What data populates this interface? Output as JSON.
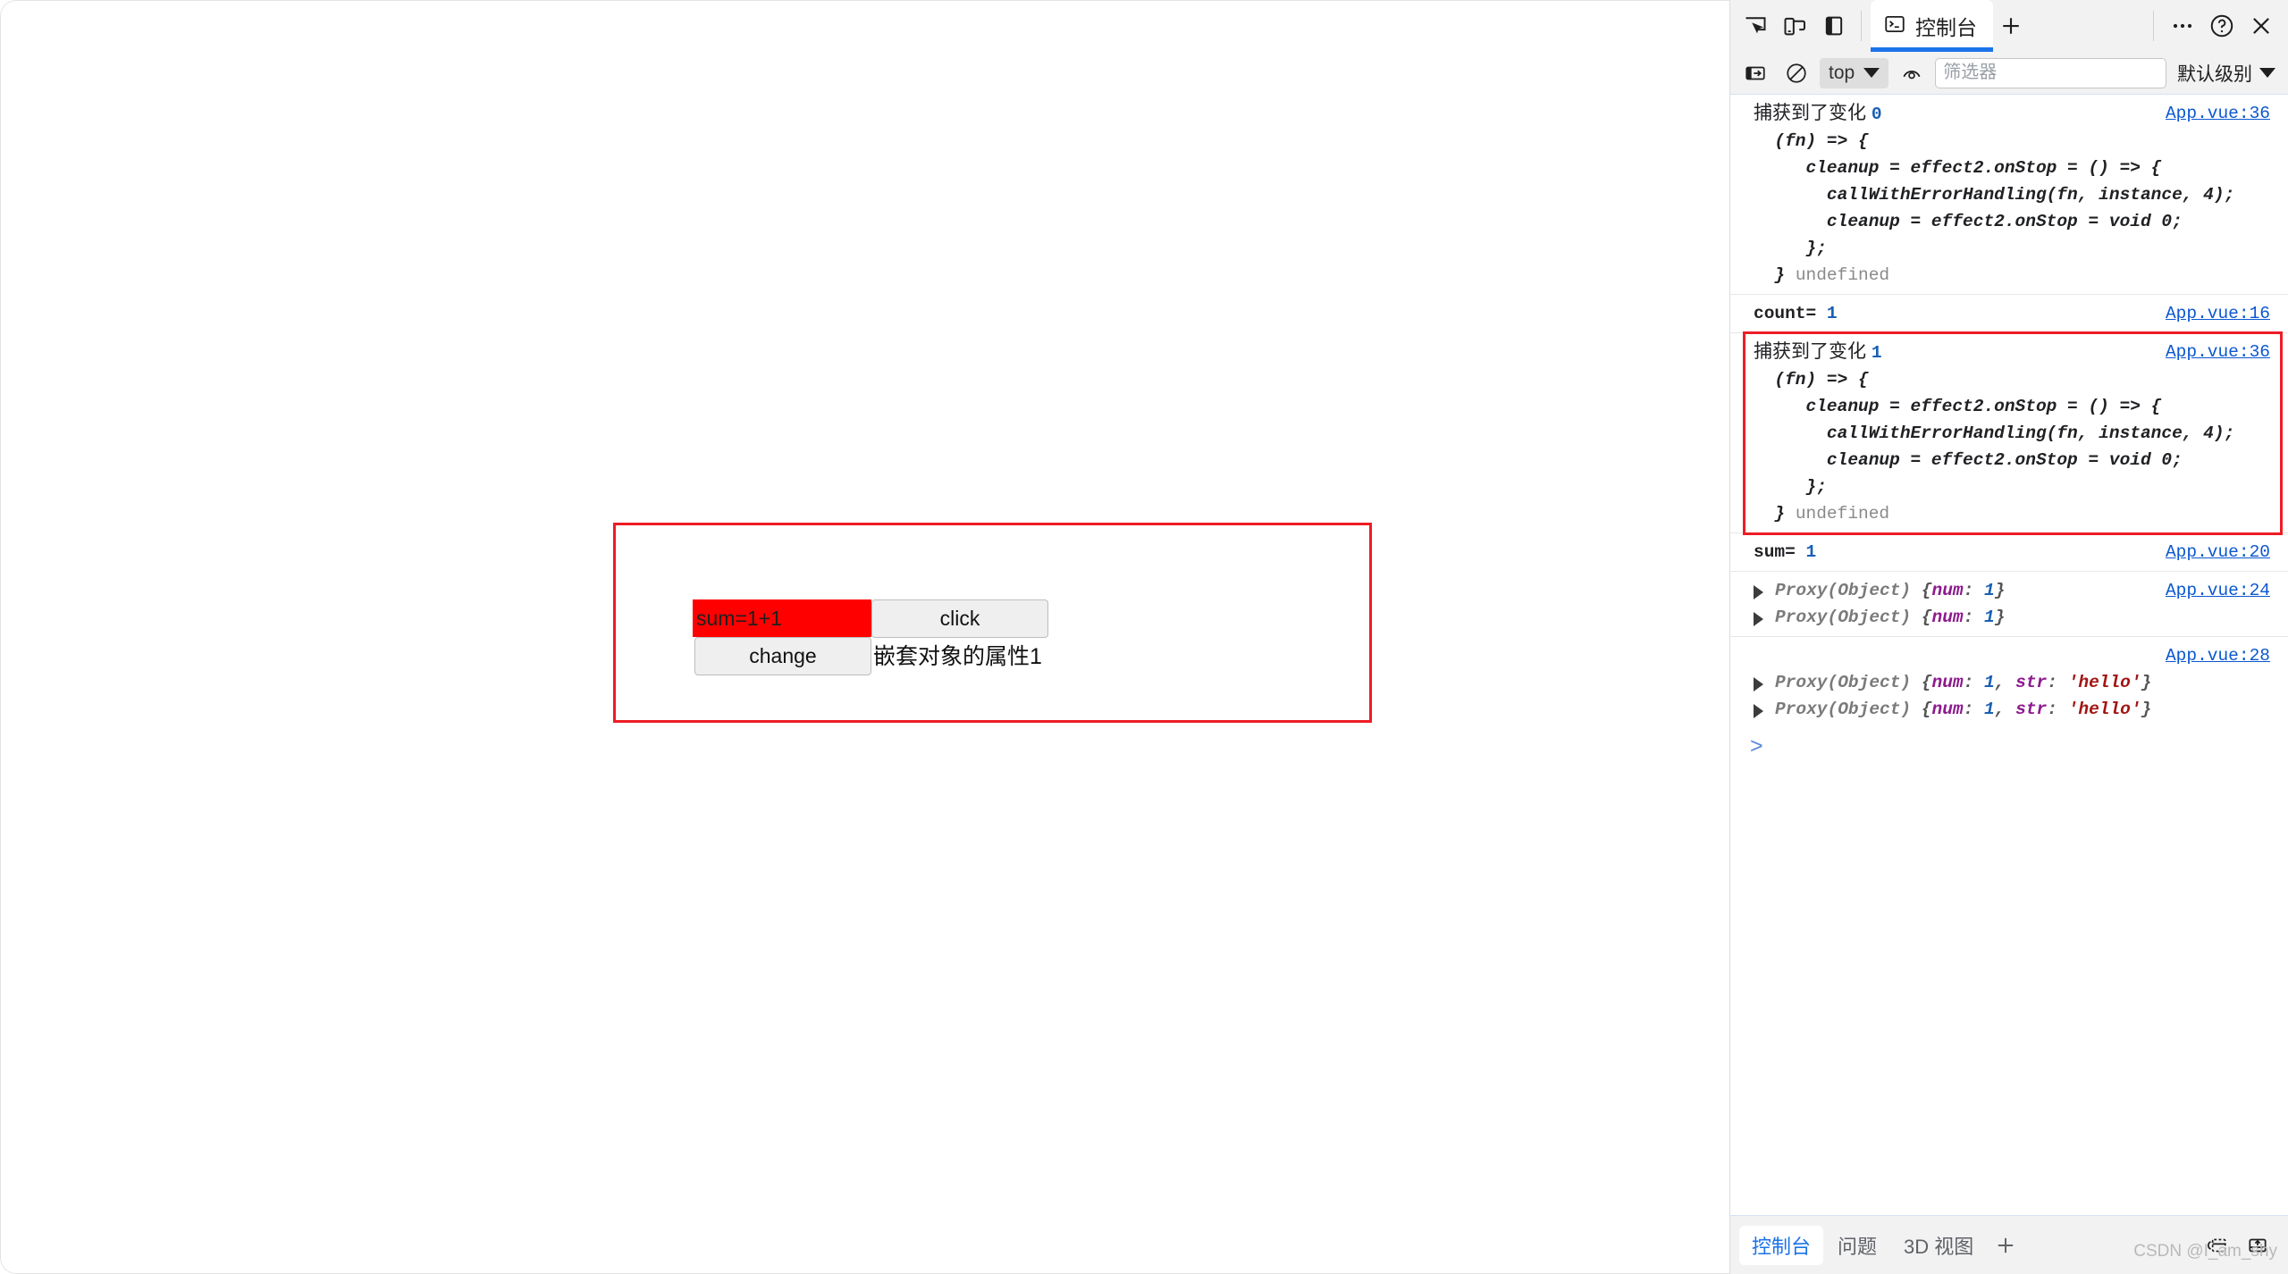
{
  "page": {
    "demo": {
      "sum_input_value": "sum=1+1",
      "sum_input_bg": "#ff0000",
      "click_button_label": "click",
      "change_button_label": "change",
      "nested_prop_text": "嵌套对象的属性1",
      "border_color": "#ee1c25"
    }
  },
  "devtools": {
    "tabstrip": {
      "inspect_icon": "inspect-element-icon",
      "device_toggle_icon": "device-toolbar-icon",
      "panel_layout_icon": "panel-layout-icon",
      "console_tab_label": "控制台",
      "console_tab_icon": "console-terminal-icon",
      "add_tab_label": "+",
      "more_label": "⋯",
      "help_label": "?",
      "close_label": "✕",
      "active_accent": "#1a73e8"
    },
    "toolbar": {
      "sidebar_toggle_icon": "console-sidebar-icon",
      "clear_console_icon": "clear-console-icon",
      "context_value": "top",
      "live_expression_icon": "eye-icon",
      "filter_placeholder": "筛选器",
      "filter_value": "",
      "levels_label": "默认级别"
    },
    "console": {
      "annotation_box_color": "#ee1c25",
      "prompt_symbol": ">",
      "groups": [
        {
          "id": "captured-change-0",
          "highlighted": false,
          "source": "App.vue:36",
          "lines": [
            {
              "type": "cjk",
              "text": "捕获到了变化 ",
              "num": "0"
            },
            {
              "type": "code",
              "text": "  (fn) => {"
            },
            {
              "type": "code",
              "text": "     cleanup = effect2.onStop = () => {"
            },
            {
              "type": "code",
              "text": "       callWithErrorHandling(fn, instance, 4);"
            },
            {
              "type": "code",
              "text": "       cleanup = effect2.onStop = void 0;"
            },
            {
              "type": "code",
              "text": "     };"
            },
            {
              "type": "code-tail",
              "text": "  } ",
              "tail": "undefined"
            }
          ]
        },
        {
          "id": "count-log",
          "highlighted": false,
          "source": "App.vue:16",
          "lines": [
            {
              "type": "label-num",
              "text": "count= ",
              "num": "1"
            }
          ]
        },
        {
          "id": "captured-change-1",
          "highlighted": true,
          "source": "App.vue:36",
          "lines": [
            {
              "type": "cjk",
              "text": "捕获到了变化 ",
              "num": "1"
            },
            {
              "type": "code",
              "text": "  (fn) => {"
            },
            {
              "type": "code",
              "text": "     cleanup = effect2.onStop = () => {"
            },
            {
              "type": "code",
              "text": "       callWithErrorHandling(fn, instance, 4);"
            },
            {
              "type": "code",
              "text": "       cleanup = effect2.onStop = void 0;"
            },
            {
              "type": "code",
              "text": "     };"
            },
            {
              "type": "code-tail",
              "text": "  } ",
              "tail": "undefined"
            }
          ]
        },
        {
          "id": "sum-log",
          "highlighted": false,
          "source": "App.vue:20",
          "lines": [
            {
              "type": "label-num",
              "text": "sum= ",
              "num": "1"
            }
          ]
        },
        {
          "id": "proxy-num-group",
          "highlighted": false,
          "source": "App.vue:24",
          "lines": [
            {
              "type": "proxy",
              "prefix": "Proxy(Object) ",
              "body": "{num: 1}"
            },
            {
              "type": "proxy",
              "prefix": "Proxy(Object) ",
              "body": "{num: 1}"
            }
          ]
        },
        {
          "id": "proxy-num-str-group",
          "highlighted": false,
          "source": "App.vue:28",
          "source_on_own_line": true,
          "lines": [
            {
              "type": "proxy",
              "prefix": "Proxy(Object) ",
              "body": "{num: 1, str: 'hello'}"
            },
            {
              "type": "proxy",
              "prefix": "Proxy(Object) ",
              "body": "{num: 1, str: 'hello'}"
            }
          ]
        }
      ]
    },
    "drawer": {
      "tabs": [
        {
          "label": "控制台",
          "active": true
        },
        {
          "label": "问题",
          "active": false
        },
        {
          "label": "3D 视图",
          "active": false
        }
      ],
      "add_tab_label": "+",
      "restore_icon": "restore-drawer-icon",
      "export_icon": "export-icon",
      "watermark": "CSDN @I_am_shy"
    }
  }
}
